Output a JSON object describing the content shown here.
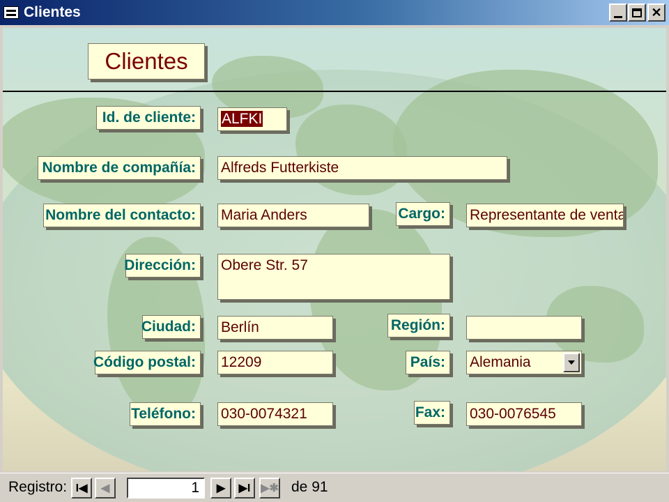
{
  "window": {
    "title": "Clientes"
  },
  "form": {
    "title": "Clientes",
    "fields": {
      "id": {
        "label": "Id. de cliente:",
        "value": "ALFKI"
      },
      "company": {
        "label": "Nombre de compañía:",
        "value": "Alfreds Futterkiste"
      },
      "contact": {
        "label": "Nombre del contacto:",
        "value": "Maria Anders"
      },
      "position": {
        "label": "Cargo:",
        "value": "Representante de ventas"
      },
      "address": {
        "label": "Dirección:",
        "value": "Obere Str. 57"
      },
      "city": {
        "label": "Ciudad:",
        "value": "Berlín"
      },
      "region": {
        "label": "Región:",
        "value": ""
      },
      "postal": {
        "label": "Código postal:",
        "value": "12209"
      },
      "country": {
        "label": "País:",
        "value": "Alemania"
      },
      "phone": {
        "label": "Teléfono:",
        "value": "030-0074321"
      },
      "fax": {
        "label": "Fax:",
        "value": "030-0076545"
      }
    }
  },
  "navigation": {
    "label": "Registro:",
    "current": "1",
    "of_label": "de",
    "total": "91"
  },
  "colors": {
    "label_text": "#006666",
    "value_text": "#5a0000",
    "box_fill": "#ffffd9",
    "title_text": "#7a0000"
  },
  "icons": [
    "form-icon",
    "minimize-icon",
    "maximize-icon",
    "close-icon",
    "first-record-icon",
    "previous-record-icon",
    "next-record-icon",
    "last-record-icon",
    "new-record-icon",
    "dropdown-arrow-icon"
  ]
}
